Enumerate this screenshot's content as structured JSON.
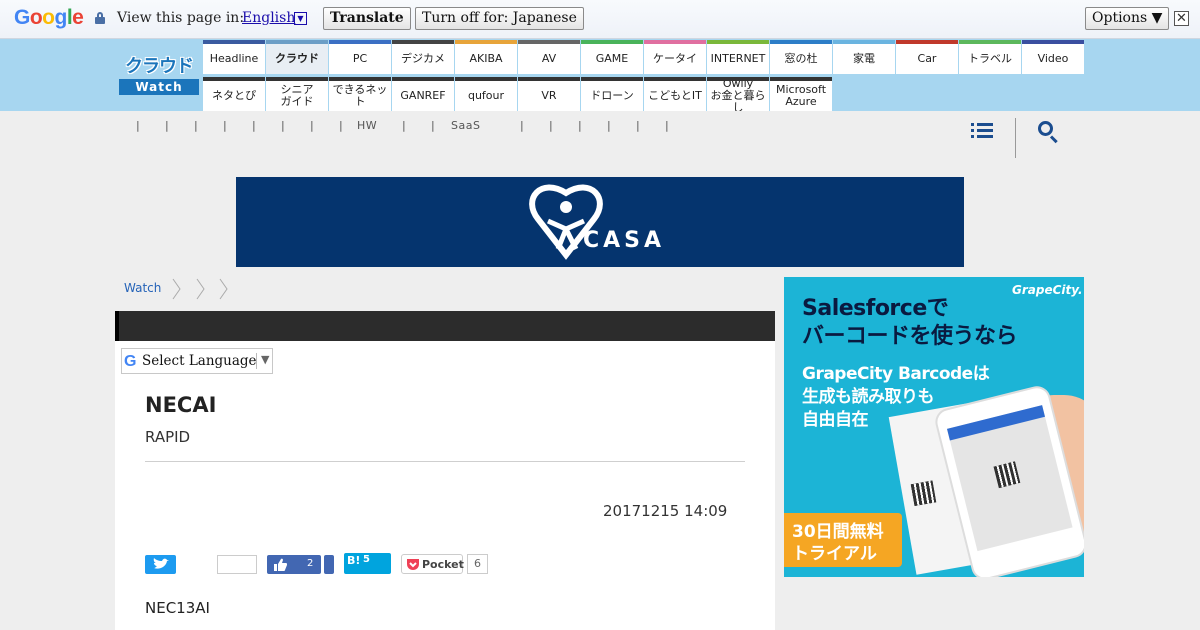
{
  "translate_bar": {
    "logo": "Google",
    "view_text": "View this page in:",
    "language": "English",
    "translate_label": "Translate",
    "turn_off_label": "Turn off for: Japanese",
    "options_label": "Options ▼",
    "close_glyph": "✕"
  },
  "site": {
    "logo_top": "クラウド",
    "logo_bottom": "Watch",
    "nav_row1": [
      {
        "label": "Headline",
        "color": "#3a5ba0"
      },
      {
        "label": "クラウド",
        "color": "#6c9ec6",
        "active": true
      },
      {
        "label": "PC",
        "color": "#3b6fc4"
      },
      {
        "label": "デジカメ",
        "color": "#444444"
      },
      {
        "label": "AKIBA",
        "color": "#e7a43a"
      },
      {
        "label": "AV",
        "color": "#666666"
      },
      {
        "label": "GAME",
        "color": "#49b35a"
      },
      {
        "label": "ケータイ",
        "color": "#e06fa0"
      },
      {
        "label": "INTERNET",
        "color": "#7ab83a"
      },
      {
        "label": "窓の杜",
        "color": "#2d7ec8"
      },
      {
        "label": "家電",
        "color": "#6ab4e0"
      },
      {
        "label": "Car",
        "color": "#c0392b"
      },
      {
        "label": "トラベル",
        "color": "#5cb85c"
      },
      {
        "label": "Video",
        "color": "#3a4fa0"
      }
    ],
    "nav_row2": [
      {
        "label": "ネタとぴ",
        "color": "#333333"
      },
      {
        "label": "シニア\nガイド",
        "color": "#333333"
      },
      {
        "label": "できるネット",
        "color": "#333333"
      },
      {
        "label": "GANREF",
        "color": "#333333"
      },
      {
        "label": "qufour",
        "color": "#333333"
      },
      {
        "label": "VR",
        "color": "#333333"
      },
      {
        "label": "ドローン",
        "color": "#333333"
      },
      {
        "label": "こどもとIT",
        "color": "#333333"
      },
      {
        "label": "Owlly\nお金と暮らし",
        "color": "#333333"
      },
      {
        "label": "Microsoft\nAzure",
        "color": "#333333"
      }
    ],
    "subnav": [
      "|",
      "|",
      "|",
      "|",
      "|",
      "|",
      "|",
      "|",
      "HW",
      "|",
      "|",
      "SaaS",
      "|",
      "|",
      "|",
      "|",
      "|",
      "|"
    ]
  },
  "banner": {
    "text": "CASA"
  },
  "breadcrumb": {
    "home": "Watch"
  },
  "translate_widget": {
    "g": "G",
    "label": "Select Language",
    "arrow": "▼"
  },
  "article": {
    "title": "NECAI",
    "subtitle": "RAPID",
    "date": "20171215 14:09",
    "body": "NEC13AI"
  },
  "share": {
    "fb_count": "2",
    "hatena_label": "B!",
    "hatena_count": "5",
    "pocket_label": "Pocket",
    "pocket_count": "6"
  },
  "ad": {
    "brand": "GrapeCity.",
    "headline": "Salesforceで\nバーコードを使うなら",
    "subhead": "GrapeCity Barcodeは\n生成も読み取りも\n自由自在",
    "cta": "30日間無料\nトライアル"
  }
}
